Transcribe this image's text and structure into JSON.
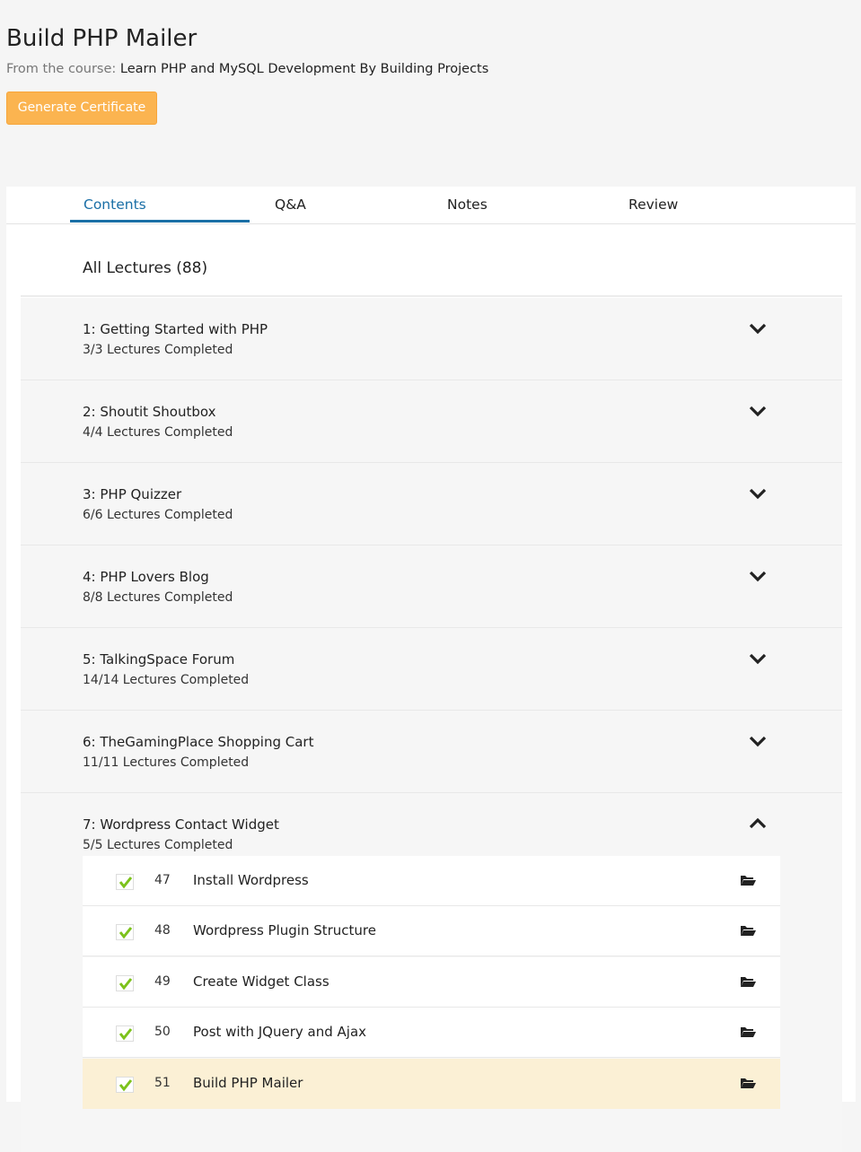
{
  "header": {
    "title": "Build PHP Mailer",
    "from_label": "From the course:",
    "course_name": "Learn PHP and MySQL Development By Building Projects",
    "certificate_button": "Generate Certificate"
  },
  "tabs": [
    {
      "label": "Contents",
      "active": true
    },
    {
      "label": "Q&A",
      "active": false
    },
    {
      "label": "Notes",
      "active": false
    },
    {
      "label": "Review",
      "active": false
    }
  ],
  "all_lectures_label": "All Lectures (88)",
  "sections": [
    {
      "title": "1: Getting Started with PHP",
      "completed": "3/3 Lectures Completed",
      "expanded": false
    },
    {
      "title": "2: Shoutit Shoutbox",
      "completed": "4/4 Lectures Completed",
      "expanded": false
    },
    {
      "title": "3: PHP Quizzer",
      "completed": "6/6 Lectures Completed",
      "expanded": false
    },
    {
      "title": "4: PHP Lovers Blog",
      "completed": "8/8 Lectures Completed",
      "expanded": false
    },
    {
      "title": "5: TalkingSpace Forum",
      "completed": "14/14 Lectures Completed",
      "expanded": false
    },
    {
      "title": "6: TheGamingPlace Shopping Cart",
      "completed": "11/11 Lectures Completed",
      "expanded": false
    },
    {
      "title": "7: Wordpress Contact Widget",
      "completed": "5/5 Lectures Completed",
      "expanded": true
    }
  ],
  "lectures": [
    {
      "number": "47",
      "title": "Install Wordpress",
      "current": false
    },
    {
      "number": "48",
      "title": "Wordpress Plugin Structure",
      "current": false
    },
    {
      "number": "49",
      "title": "Create Widget Class",
      "current": false
    },
    {
      "number": "50",
      "title": "Post with JQuery and Ajax",
      "current": false
    },
    {
      "number": "51",
      "title": "Build PHP Mailer",
      "current": true
    }
  ],
  "colors": {
    "accent": "#1a6fa6",
    "certificate_button": "#fbb450",
    "check_green": "#7cc21b",
    "current_row": "#fbf0d5"
  }
}
